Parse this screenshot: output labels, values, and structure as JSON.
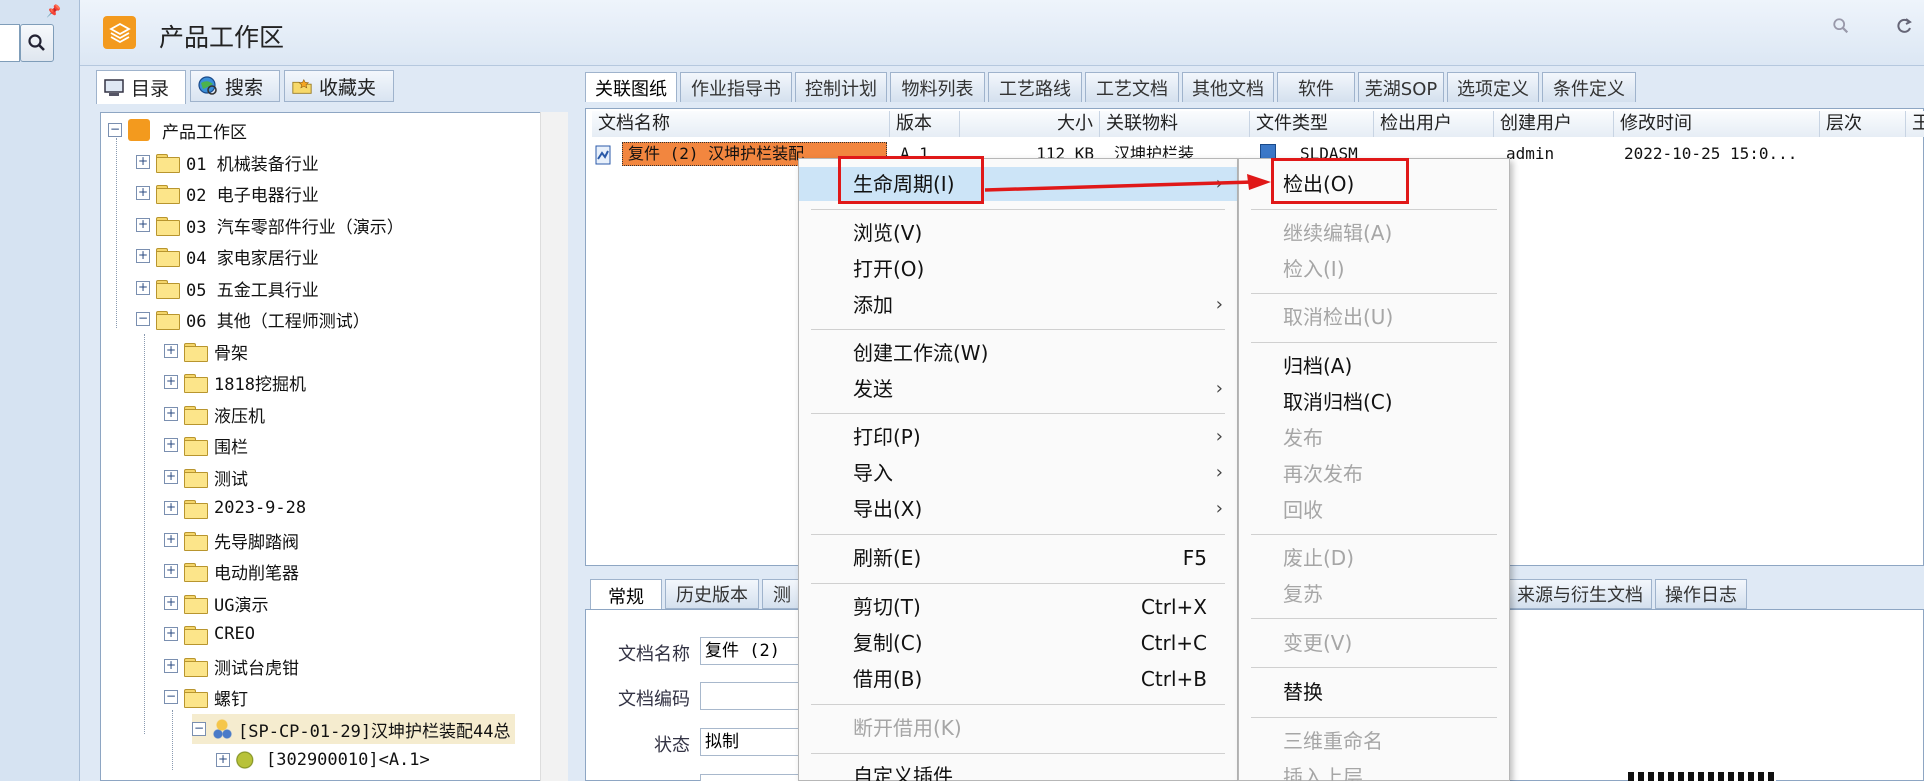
{
  "header": {
    "title": "产品工作区"
  },
  "left_tabs": [
    {
      "label": "目录",
      "icon": "computer-icon"
    },
    {
      "label": "搜索",
      "icon": "globe-search-icon"
    },
    {
      "label": "收藏夹",
      "icon": "favorites-icon"
    }
  ],
  "tree": {
    "root": "产品工作区",
    "items": [
      "01 机械装备行业",
      "02 电子电器行业",
      "03 汽车零部件行业（演示）",
      "04 家电家居行业",
      "05 五金工具行业",
      "06 其他（工程师测试）",
      "骨架",
      "1818挖掘机",
      "液压机",
      "围栏",
      "测试",
      "2023-9-28",
      "先导脚踏阀",
      "电动削笔器",
      "UG演示",
      "CREO",
      "测试台虎钳",
      "螺钉",
      "[SP-CP-01-29]汉坤护栏装配44总",
      "[302900010]<A.1>"
    ]
  },
  "doc_tabs": [
    "关联图纸",
    "作业指导书",
    "控制计划",
    "物料列表",
    "工艺路线",
    "工艺文档",
    "其他文档",
    "软件",
    "芜湖SOP",
    "选项定义",
    "条件定义"
  ],
  "columns": [
    "文档名称",
    "版本",
    "大小",
    "关联物料",
    "文件类型",
    "检出用户",
    "创建用户",
    "修改时间",
    "层次",
    "王"
  ],
  "row": {
    "name": "复件 (2) 汉坤护栏装配",
    "version": "A.1",
    "size": "112 KB",
    "material": "汉坤护栏装",
    "type": "SLDASM",
    "creator": "admin",
    "modified": "2022-10-25 15:0..."
  },
  "bottom_tabs": [
    "常规",
    "历史版本",
    "测",
    "来源与衍生文档",
    "操作日志"
  ],
  "props": {
    "name_label": "文档名称",
    "name_value": "复件 (2)",
    "code_label": "文档编码",
    "status_label": "状态",
    "status_value": "拟制"
  },
  "context_menu": {
    "items": [
      {
        "label": "生命周期(I)",
        "submenu": true,
        "highlighted": true
      },
      {
        "label": "浏览(V)"
      },
      {
        "label": "打开(O)"
      },
      {
        "label": "添加",
        "submenu": true
      },
      {
        "label": "创建工作流(W)"
      },
      {
        "label": "发送",
        "submenu": true
      },
      {
        "label": "打印(P)",
        "submenu": true
      },
      {
        "label": "导入",
        "submenu": true
      },
      {
        "label": "导出(X)",
        "submenu": true
      },
      {
        "label": "刷新(E)",
        "shortcut": "F5"
      },
      {
        "label": "剪切(T)",
        "shortcut": "Ctrl+X"
      },
      {
        "label": "复制(C)",
        "shortcut": "Ctrl+C"
      },
      {
        "label": "借用(B)",
        "shortcut": "Ctrl+B"
      },
      {
        "label": "断开借用(K)",
        "disabled": true
      },
      {
        "label": "自定义插件"
      }
    ]
  },
  "submenu": {
    "items": [
      {
        "label": "检出(O)"
      },
      {
        "label": "继续编辑(A)",
        "disabled": true
      },
      {
        "label": "检入(I)",
        "disabled": true
      },
      {
        "label": "取消检出(U)",
        "disabled": true
      },
      {
        "label": "归档(A)"
      },
      {
        "label": "取消归档(C)"
      },
      {
        "label": "发布",
        "disabled": true
      },
      {
        "label": "再次发布",
        "disabled": true
      },
      {
        "label": "回收",
        "disabled": true
      },
      {
        "label": "废止(D)",
        "disabled": true
      },
      {
        "label": "复苏",
        "disabled": true
      },
      {
        "label": "变更(V)",
        "disabled": true
      },
      {
        "label": "替换"
      },
      {
        "label": "三维重命名",
        "disabled": true
      },
      {
        "label": "插入上层",
        "disabled": true
      }
    ]
  },
  "colors": {
    "highlight_red": "#e01818",
    "selection_orange": "#f2863f",
    "menu_hover": "#cce4f7"
  }
}
